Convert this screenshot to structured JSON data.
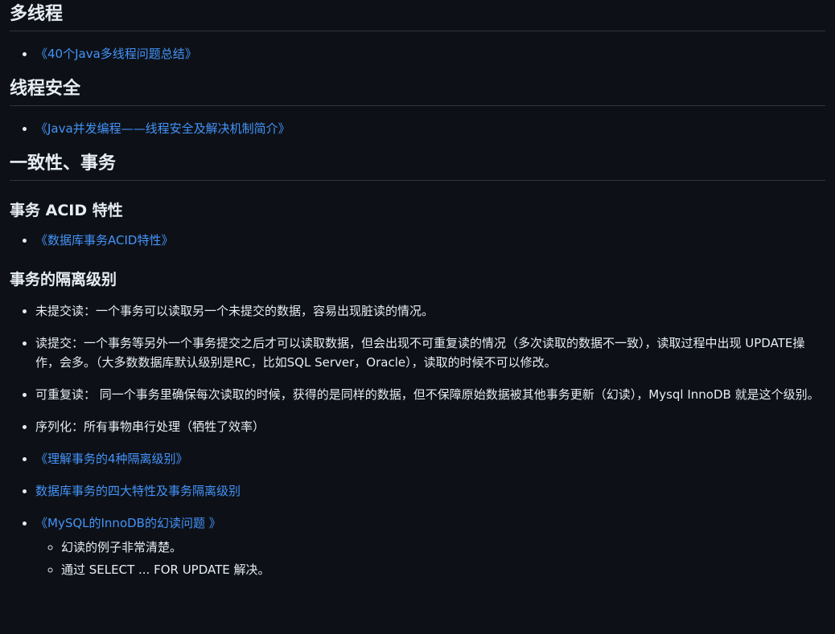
{
  "sections": [
    {
      "title": "多线程",
      "links": [
        "《40个Java多线程问题总结》"
      ]
    },
    {
      "title": "线程安全",
      "links": [
        "《Java并发编程——线程安全及解决机制简介》"
      ]
    },
    {
      "title": "一致性、事务"
    }
  ],
  "acid": {
    "title": "事务 ACID 特性",
    "link": "《数据库事务ACID特性》"
  },
  "isolation": {
    "title": "事务的隔离级别",
    "items": [
      "未提交读：一个事务可以读取另一个未提交的数据，容易出现脏读的情况。",
      "读提交：一个事务等另外一个事务提交之后才可以读取数据，但会出现不可重复读的情况（多次读取的数据不一致），读取过程中出现 UPDATE操作，会多。（大多数数据库默认级别是RC，比如SQL Server，Oracle），读取的时候不可以修改。",
      "可重复读： 同一个事务里确保每次读取的时候，获得的是同样的数据，但不保障原始数据被其他事务更新（幻读），Mysql InnoDB 就是这个级别。",
      "序列化：所有事物串行处理（牺牲了效率）"
    ],
    "links": [
      "《理解事务的4种隔离级别》",
      "数据库事务的四大特性及事务隔离级别",
      "《MySQL的InnoDB的幻读问题 》"
    ],
    "sub_items": [
      "幻读的例子非常清楚。",
      "通过 SELECT ... FOR UPDATE 解决。"
    ]
  }
}
